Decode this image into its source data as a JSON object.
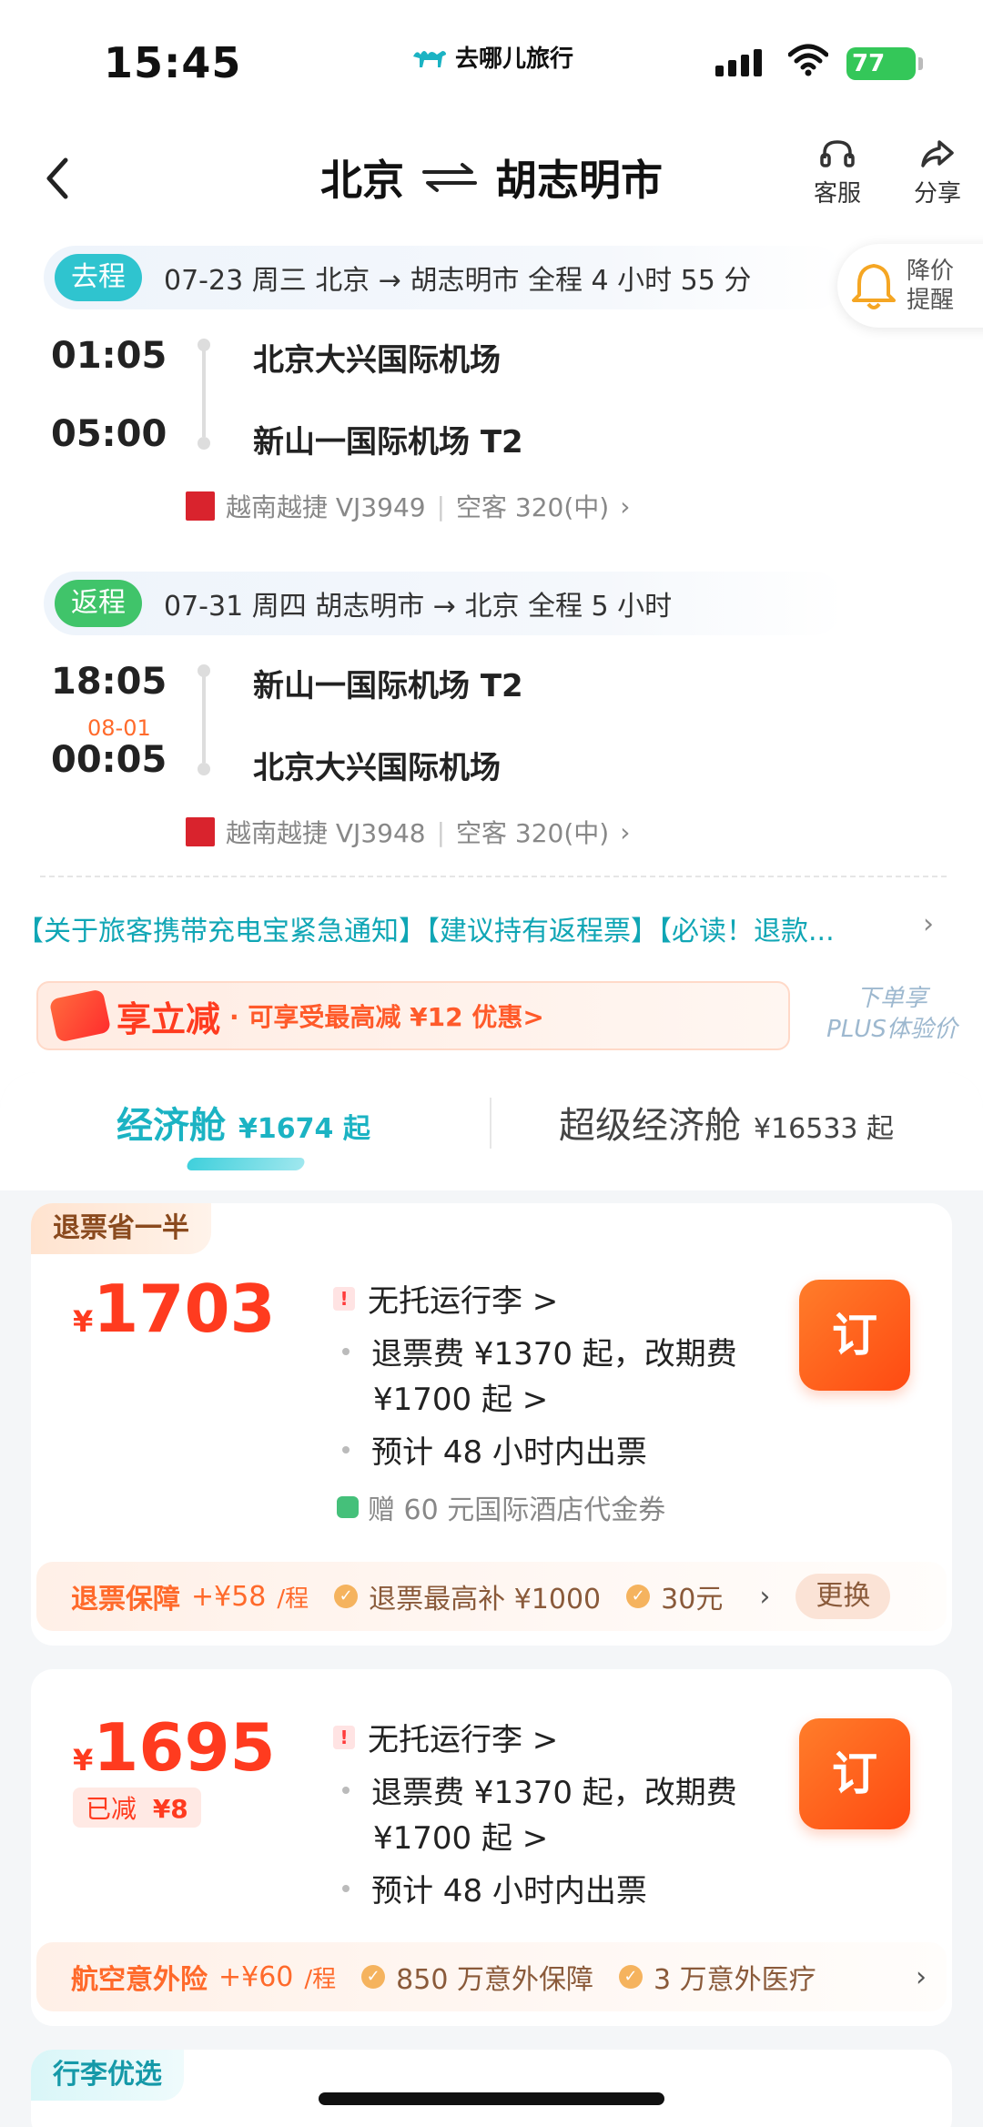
{
  "status_bar": {
    "time": "15:45",
    "brand": "去哪儿旅行",
    "battery": "77"
  },
  "nav": {
    "title_from": "北京",
    "title_to": "胡志明市",
    "service_label": "客服",
    "share_label": "分享"
  },
  "outbound": {
    "tag": "去程",
    "info": "07-23 周三   北京 → 胡志明市   全程 4 小时 55 分",
    "dep_time": "01:05",
    "dep_airport": "北京大兴国际机场",
    "arr_time": "05:00",
    "arr_airport": "新山一国际机场 T2",
    "airline": "越南越捷 VJ3949",
    "aircraft": "空客 320(中)"
  },
  "price_alert": {
    "line1": "降价",
    "line2": "提醒"
  },
  "inbound": {
    "tag": "返程",
    "info": "07-31 周四   胡志明市 → 北京   全程 5 小时",
    "dep_time": "18:05",
    "arr_date": "08-01",
    "arr_time": "00:05",
    "dep_airport": "新山一国际机场 T2",
    "arr_airport": "北京大兴国际机场",
    "airline": "越南越捷 VJ3948",
    "aircraft": "空客 320(中)"
  },
  "notice": "【关于旅客携带充电宝紧急通知】【建议持有返程票】【必读！退款...",
  "promo": {
    "title": "享立减",
    "subtitle": "· 可享受最高减 ¥12 优惠>",
    "plus_line1": "下单享",
    "plus_line2": "PLUS体验价"
  },
  "tabs": [
    {
      "name": "经济舱",
      "price": "¥1674 起"
    },
    {
      "name": "超级经济舱",
      "price": "¥16533 起"
    }
  ],
  "cards": [
    {
      "tag": "退票省一半",
      "currency": "¥",
      "price": "1703",
      "features": [
        "无托运行李 >",
        "退票费 ¥1370 起，改期费",
        "¥1700 起 >",
        "预计 48 小时内出票"
      ],
      "gift": "赠 60 元国际酒店代金券",
      "book": "订",
      "ins_title": "退票保障",
      "ins_price": "+¥58",
      "ins_unit": "/程",
      "ins_items": [
        "退票最高补 ¥1000",
        "30元"
      ],
      "swap": "更换"
    },
    {
      "currency": "¥",
      "price": "1695",
      "discount_label": "已减",
      "discount_value": "¥8",
      "features": [
        "无托运行李 >",
        "退票费 ¥1370 起，改期费",
        "¥1700 起 >",
        "预计 48 小时内出票"
      ],
      "book": "订",
      "ins_title": "航空意外险",
      "ins_price": "+¥60",
      "ins_unit": "/程",
      "ins_items": [
        "850 万意外保障",
        "3 万意外医疗"
      ]
    },
    {
      "tag": "行李优选"
    }
  ]
}
